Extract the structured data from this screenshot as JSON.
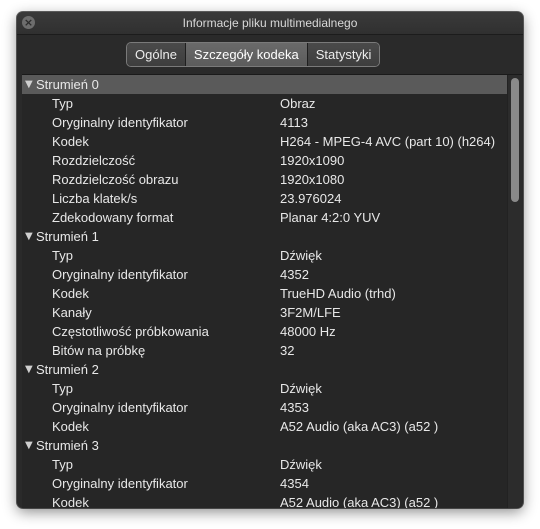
{
  "window": {
    "title": "Informacje pliku multimedialnego"
  },
  "tabs": [
    {
      "label": "Ogólne",
      "active": false
    },
    {
      "label": "Szczegóły kodeka",
      "active": true
    },
    {
      "label": "Statystyki",
      "active": false
    }
  ],
  "streams": [
    {
      "label": "Strumień 0",
      "rows": [
        {
          "key": "Typ",
          "value": "Obraz"
        },
        {
          "key": "Oryginalny identyfikator",
          "value": "4113"
        },
        {
          "key": "Kodek",
          "value": "H264 - MPEG-4 AVC (part 10) (h264)"
        },
        {
          "key": "Rozdzielczość",
          "value": "1920x1090"
        },
        {
          "key": "Rozdzielczość obrazu",
          "value": "1920x1080"
        },
        {
          "key": "Liczba klatek/s",
          "value": "23.976024"
        },
        {
          "key": "Zdekodowany format",
          "value": "Planar 4:2:0 YUV"
        }
      ]
    },
    {
      "label": "Strumień 1",
      "rows": [
        {
          "key": "Typ",
          "value": "Dźwięk"
        },
        {
          "key": "Oryginalny identyfikator",
          "value": "4352"
        },
        {
          "key": "Kodek",
          "value": "TrueHD Audio (trhd)"
        },
        {
          "key": "Kanały",
          "value": "3F2M/LFE"
        },
        {
          "key": "Częstotliwość próbkowania",
          "value": "48000 Hz"
        },
        {
          "key": "Bitów na próbkę",
          "value": "32"
        }
      ]
    },
    {
      "label": "Strumień 2",
      "rows": [
        {
          "key": "Typ",
          "value": "Dźwięk"
        },
        {
          "key": "Oryginalny identyfikator",
          "value": "4353"
        },
        {
          "key": "Kodek",
          "value": "A52 Audio (aka AC3) (a52 )"
        }
      ]
    },
    {
      "label": "Strumień 3",
      "rows": [
        {
          "key": "Typ",
          "value": "Dźwięk"
        },
        {
          "key": "Oryginalny identyfikator",
          "value": "4354"
        },
        {
          "key": "Kodek",
          "value": "A52 Audio (aka AC3) (a52 )"
        }
      ]
    }
  ],
  "selected_stream_index": 0,
  "icons": {
    "close": "close-icon",
    "disclosure": "disclosure-triangle-expanded-icon"
  },
  "colors": {
    "window_bg": "#2a2a2a",
    "selected_row_bg": "#5a5a5a",
    "text": "#e8e8e8"
  }
}
